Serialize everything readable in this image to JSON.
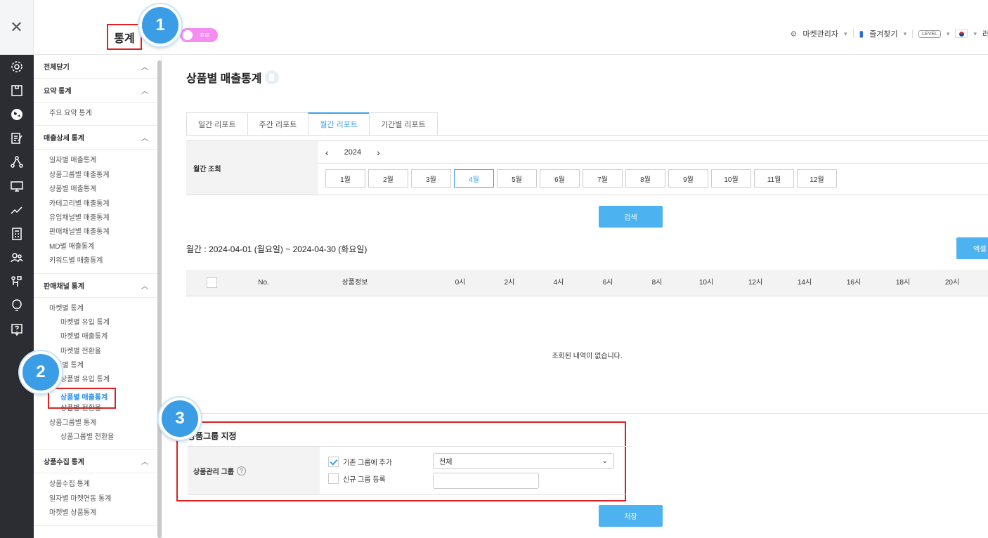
{
  "header": {
    "title": "통계",
    "pro_label": "프로",
    "market_admin": "마켓관리자",
    "favorites": "즐겨찾기",
    "level": "LEVEL",
    "truncated_text": "러"
  },
  "annotations": {
    "badge1": "1",
    "badge2": "2",
    "badge3": "3"
  },
  "sidebar": {
    "collapse_all": "전체닫기",
    "sections": [
      {
        "title": "요약 통계",
        "items": [
          "주요 요약 통계"
        ]
      },
      {
        "title": "매출상세 통계",
        "items": [
          "일자별 매출통계",
          "상품그룹별 매출통계",
          "상품별 매출통계",
          "카테고리별 매출통계",
          "유입채널별 매출통계",
          "판매채널별 매출통계",
          "MD별 매출통계",
          "키워드별 매출통계"
        ]
      },
      {
        "title": "판매채널 통계",
        "items": [
          "마켓별 통계",
          "마켓별 유입 통계",
          "마켓별 매출통계",
          "마켓별 전환율",
          "상품별 통계",
          "상품별 유입 통계",
          "상품별 매출통계",
          "상품별 전환율",
          "상품그룹별 통계",
          "상품그룹별 전환율"
        ]
      },
      {
        "title": "상품수집 통계",
        "items": [
          "상품수집 통계",
          "일자별 마켓연동 통계",
          "마켓별 상품통계"
        ]
      }
    ]
  },
  "main": {
    "page_title": "상품별 매출통계",
    "tabs": [
      "일간 리포트",
      "주간 리포트",
      "월간 리포트",
      "기간별 리포트"
    ],
    "filter": {
      "label": "월간 조회",
      "year": "2024",
      "months": [
        "1월",
        "2월",
        "3월",
        "4월",
        "5월",
        "6월",
        "7월",
        "8월",
        "9월",
        "10월",
        "11월",
        "12월"
      ],
      "selected_month": "4월"
    },
    "search_button": "검색",
    "period_text": "월간 : 2024-04-01 (월요일) ~ 2024-04-30 (화요일)",
    "excel_button": "엑셀",
    "table": {
      "headers": [
        "No.",
        "상품정보",
        "0시",
        "2시",
        "4시",
        "6시",
        "8시",
        "10시",
        "12시",
        "14시",
        "16시",
        "18시",
        "20시"
      ],
      "empty_message": "조회된 내역이 없습니다."
    },
    "group": {
      "title": "상품그룹 지정",
      "label": "상품관리 그룹",
      "option_existing": "기존 그룹에 추가",
      "option_new": "신규 그룹 등록",
      "select_value": "전체",
      "existing_checked": true
    },
    "save_button": "저장"
  }
}
